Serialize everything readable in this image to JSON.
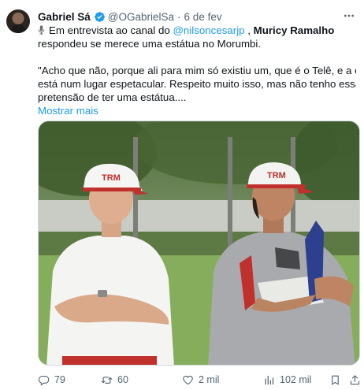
{
  "author": {
    "name": "Gabriel Sá",
    "handle": "@OGabrielSa",
    "separator": "·",
    "date": "6 de fev"
  },
  "icons": {
    "avatar": "avatar",
    "verified": "verified-badge-icon",
    "more": "more-icon",
    "mic": "microphone-icon",
    "reply": "reply-icon",
    "retweet": "retweet-icon",
    "like": "heart-icon",
    "views": "views-icon",
    "bookmark": "bookmark-icon",
    "share": "share-icon"
  },
  "colors": {
    "link": "#1d9bf0",
    "verified": "#1d9bf0",
    "secondary_text": "#536471"
  },
  "body": {
    "line1_prefix": "Em entrevista ao canal do ",
    "line1_mention": "@nilsoncesarjp",
    "line1_sep": " , ",
    "line1_bold": "Muricy Ramalho",
    "line2": "respondeu se merece uma estátua no Morumbi.",
    "quote_line1": "\"Acho que não, porque ali para mim só existiu um, que é o Telê, e a estátua",
    "quote_line2": "está num lugar espetacular. Respeito muito isso, mas não tenho essa",
    "quote_line3": "pretensão de ter uma estátua....",
    "show_more": "Mostrar mais"
  },
  "media": {
    "cap_left_text": "TRM",
    "cap_right_text": "TRM"
  },
  "actions": {
    "replies": "79",
    "retweets": "60",
    "likes": "2 mil",
    "views": "102 mil"
  }
}
